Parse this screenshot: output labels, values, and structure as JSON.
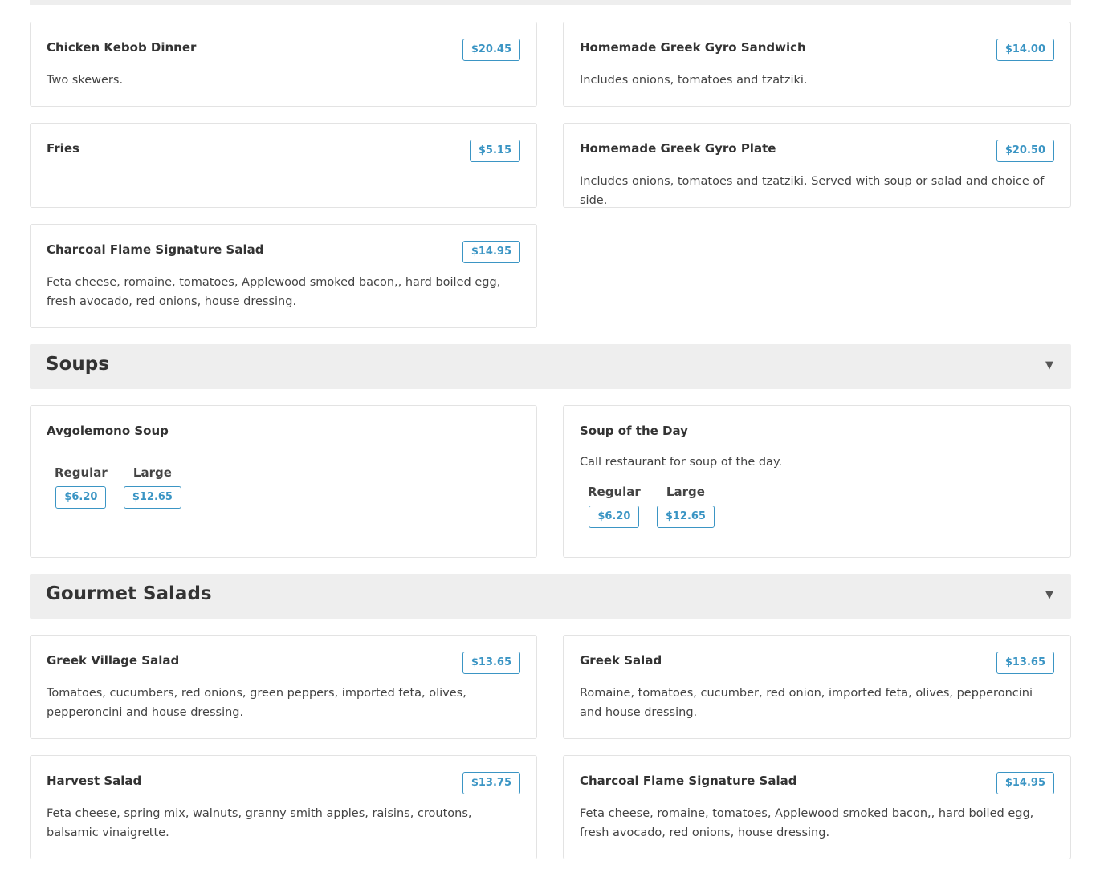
{
  "items_top": [
    {
      "name": "Chicken Kebob Dinner",
      "price": "$20.45",
      "desc": "Two skewers."
    },
    {
      "name": "Homemade Greek Gyro Sandwich",
      "price": "$14.00",
      "desc": "Includes onions, tomatoes and tzatziki."
    },
    {
      "name": "Fries",
      "price": "$5.15",
      "desc": ""
    },
    {
      "name": "Homemade Greek Gyro Plate",
      "price": "$20.50",
      "desc": "Includes onions, tomatoes and tzatziki. Served with soup or salad and choice of side."
    },
    {
      "name": "Charcoal Flame Signature Salad",
      "price": "$14.95",
      "desc": "Feta cheese, romaine, tomatoes, Applewood smoked bacon,, hard boiled egg, fresh avocado, red onions, house dressing."
    }
  ],
  "soups": {
    "title": "Soups",
    "toggle_icon": "triangle-down-icon",
    "items": [
      {
        "name": "Avgolemono Soup",
        "desc": "",
        "sizes": [
          {
            "label": "Regular",
            "price": "$6.20"
          },
          {
            "label": "Large",
            "price": "$12.65"
          }
        ]
      },
      {
        "name": "Soup of the Day",
        "desc": "Call restaurant for soup of the day.",
        "sizes": [
          {
            "label": "Regular",
            "price": "$6.20"
          },
          {
            "label": "Large",
            "price": "$12.65"
          }
        ]
      }
    ]
  },
  "salads": {
    "title": "Gourmet Salads",
    "toggle_icon": "triangle-down-icon",
    "items": [
      {
        "name": "Greek Village Salad",
        "price": "$13.65",
        "desc": "Tomatoes, cucumbers, red onions, green peppers, imported feta, olives, pepperoncini and house dressing."
      },
      {
        "name": "Greek Salad",
        "price": "$13.65",
        "desc": "Romaine, tomatoes, cucumber, red onion, imported feta, olives, pepperoncini and house dressing."
      },
      {
        "name": "Harvest Salad",
        "price": "$13.75",
        "desc": "Feta cheese, spring mix, walnuts, granny smith apples, raisins, croutons, balsamic vinaigrette."
      },
      {
        "name": "Charcoal Flame Signature Salad",
        "price": "$14.95",
        "desc": "Feta cheese, romaine, tomatoes, Applewood smoked bacon,, hard boiled egg, fresh avocado, red onions, house dressing."
      }
    ]
  },
  "colors": {
    "accent": "#3b95c4",
    "section_bg": "#eeeeee",
    "card_border": "#e3e3e3"
  }
}
